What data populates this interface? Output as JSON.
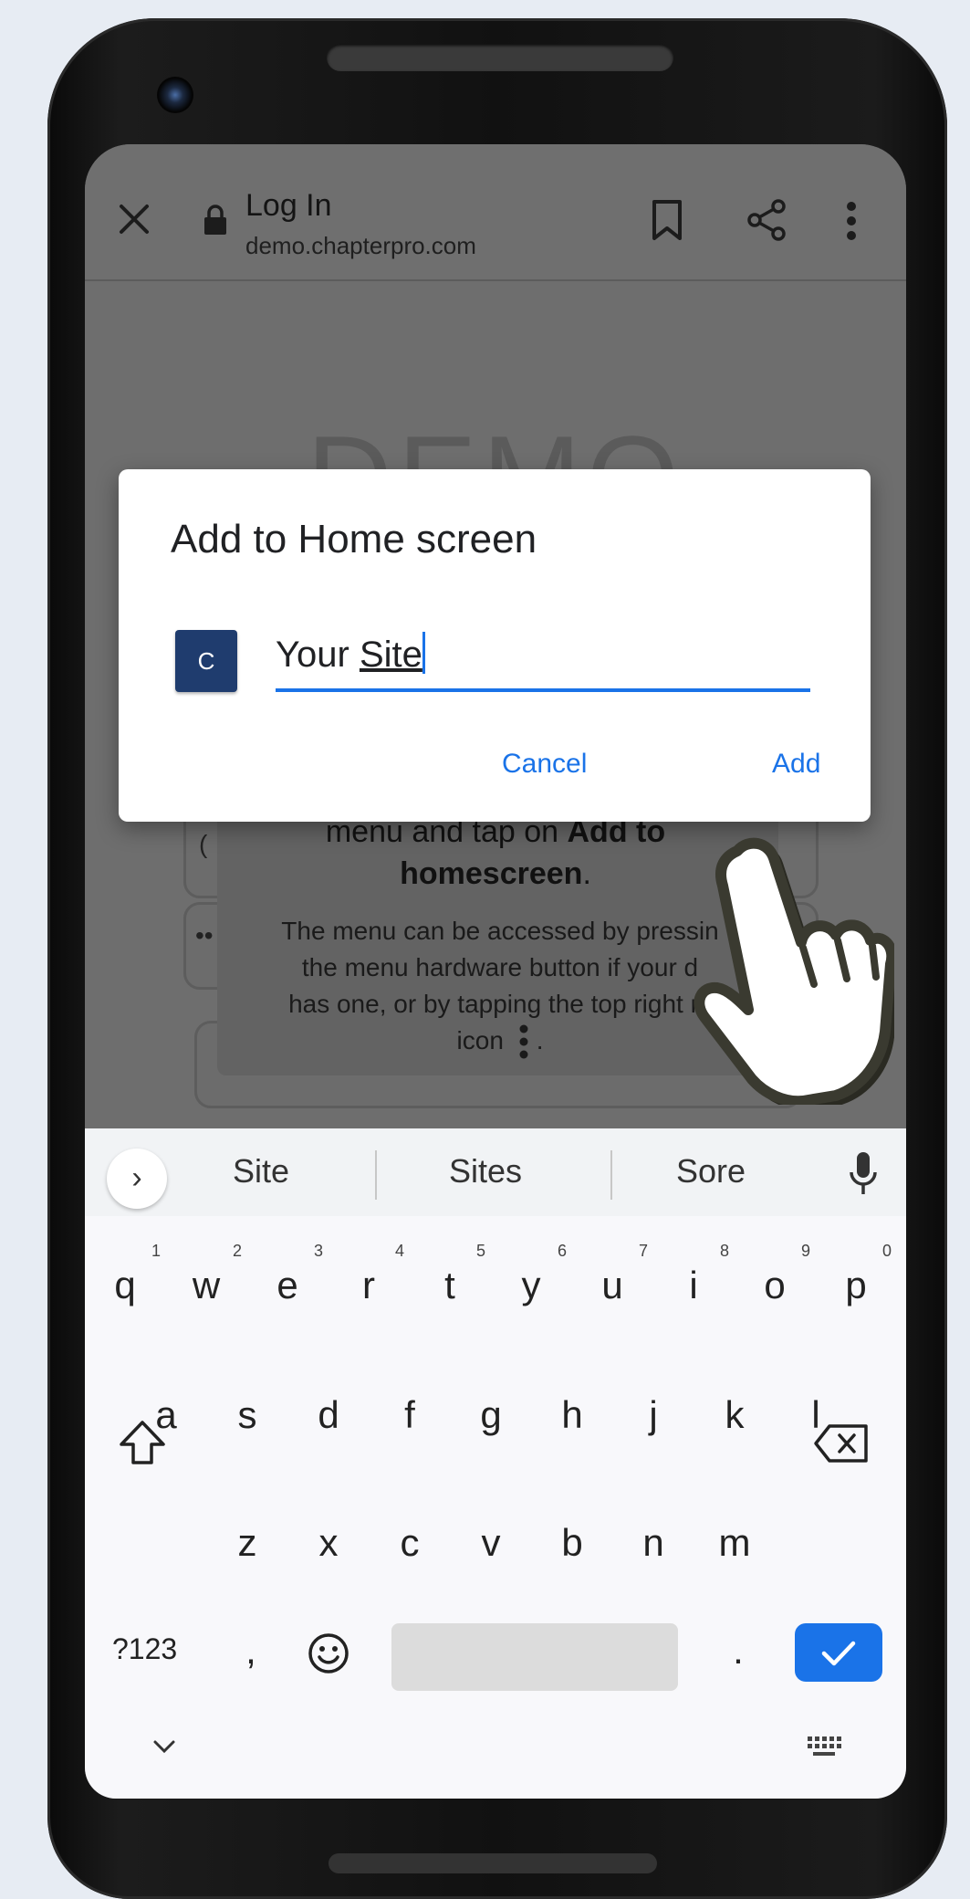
{
  "browser": {
    "page_title": "Log In",
    "url": "demo.chapterpro.com"
  },
  "background_page": {
    "logo_text": "DEMO",
    "tip_pre": "menu and tap on ",
    "tip_bold1": "Add to",
    "tip_bold2": "homescreen",
    "tip_period": ".",
    "tip_detail_1": "The menu can be accessed by pressin",
    "tip_detail_2": "the menu hardware button if your d",
    "tip_detail_3": "has one, or by tapping the top right m",
    "tip_detail_4": "icon",
    "tip_detail_end": ".",
    "ghost_mark_1": "(",
    "ghost_mark_2": "••"
  },
  "dialog": {
    "title": "Add to Home screen",
    "app_icon_letter": "C",
    "name_value": "Your Site",
    "name_prefix": "Your ",
    "name_underlined": "Site",
    "cancel_label": "Cancel",
    "add_label": "Add"
  },
  "keyboard": {
    "suggestions": [
      "Site",
      "Sites",
      "Sore"
    ],
    "row1": [
      "q",
      "w",
      "e",
      "r",
      "t",
      "y",
      "u",
      "i",
      "o",
      "p"
    ],
    "row1_hints": [
      "1",
      "2",
      "3",
      "4",
      "5",
      "6",
      "7",
      "8",
      "9",
      "0"
    ],
    "row2": [
      "a",
      "s",
      "d",
      "f",
      "g",
      "h",
      "j",
      "k",
      "l"
    ],
    "row3": [
      "z",
      "x",
      "c",
      "v",
      "b",
      "n",
      "m"
    ],
    "symbols_label": "?123",
    "comma": ",",
    "period": ".",
    "accent_color": "#1a73e8"
  }
}
